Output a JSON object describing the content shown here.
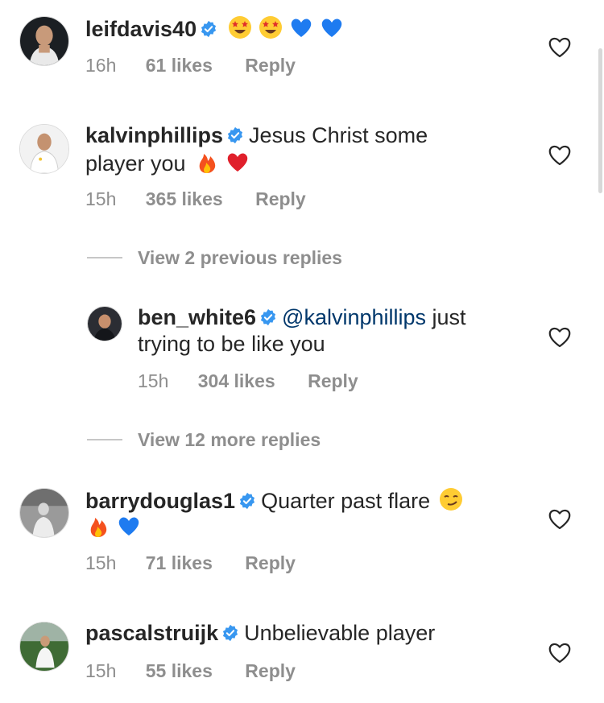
{
  "comments": [
    {
      "username": "leifdavis40",
      "text": "",
      "emojis": [
        "star-struck-emoji",
        "star-struck-emoji",
        "blue-heart-emoji",
        "blue-heart-emoji"
      ],
      "time": "16h",
      "likes": "61 likes",
      "reply": "Reply"
    },
    {
      "username": "kalvinphillips",
      "text": "Jesus Christ some",
      "text2": "player you",
      "emojis": [
        "fire-emoji",
        "red-heart-emoji"
      ],
      "time": "15h",
      "likes": "365 likes",
      "reply": "Reply"
    },
    {
      "username": "barrydouglas1",
      "text": "Quarter past flare",
      "emojis": [
        "smirk-emoji",
        "fire-emoji",
        "blue-heart-emoji"
      ],
      "time": "15h",
      "likes": "71 likes",
      "reply": "Reply"
    },
    {
      "username": "pascalstruijk",
      "text": "Unbelievable player",
      "time": "15h",
      "likes": "55 likes",
      "reply": "Reply"
    }
  ],
  "reply": {
    "username": "ben_white6",
    "mention": "@kalvinphillips",
    "text": "just",
    "text2": "trying to be like you",
    "time": "15h",
    "likes": "304 likes",
    "reply": "Reply"
  },
  "view_previous": "View 2 previous replies",
  "view_more": "View 12 more replies",
  "colors": {
    "text": "#262626",
    "meta": "#8e8e8e",
    "mention": "#00376b",
    "verified": "#3897f0"
  }
}
